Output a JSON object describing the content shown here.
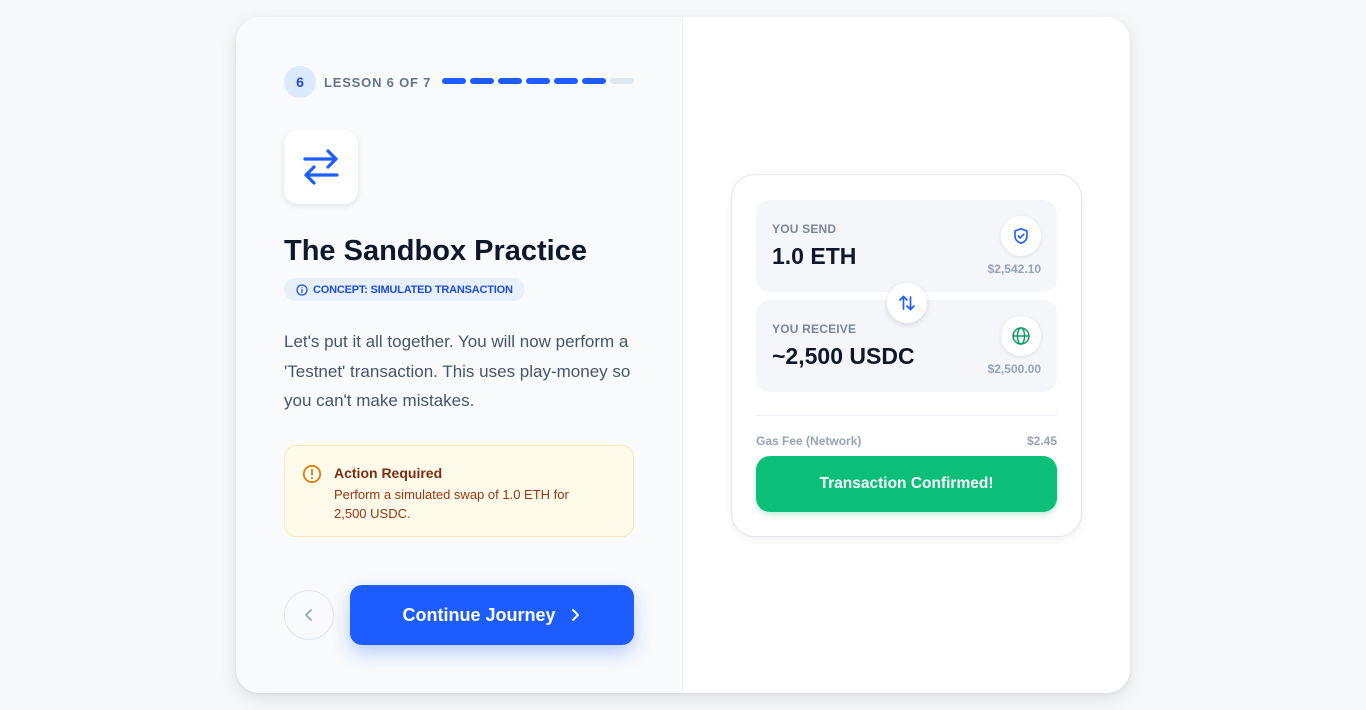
{
  "lesson": {
    "step_number": "6",
    "label": "LESSON 6 OF 7",
    "progress_completed": 6,
    "progress_total": 7
  },
  "content": {
    "icon": "arrows-left-right-icon",
    "title": "The Sandbox Practice",
    "concept_badge": "CONCEPT: SIMULATED TRANSACTION",
    "description": "Let's put it all together. You will now perform a 'Testnet' transaction. This uses play-money so you can't make mistakes."
  },
  "alert": {
    "title": "Action Required",
    "body": "Perform a simulated swap of 1.0 ETH for 2,500 USDC."
  },
  "navigation": {
    "back_icon": "chevron-left-icon",
    "continue_label": "Continue Journey",
    "continue_icon": "chevron-right-icon"
  },
  "swap": {
    "send": {
      "label": "YOU SEND",
      "amount": "1.0 ETH",
      "usd": "$2,542.10",
      "icon": "shield-check-icon"
    },
    "receive": {
      "label": "YOU RECEIVE",
      "amount": "~2,500 USDC",
      "usd": "$2,500.00",
      "icon": "globe-icon"
    },
    "swap_icon": "swap-vertical-icon",
    "gas_label": "Gas Fee (Network)",
    "gas_value": "$2.45",
    "confirm_label": "Transaction Confirmed!"
  },
  "colors": {
    "primary": "#1d5cff",
    "success": "#0bbf78",
    "warning_bg": "#fefbea",
    "warning_icon": "#e07a10"
  }
}
